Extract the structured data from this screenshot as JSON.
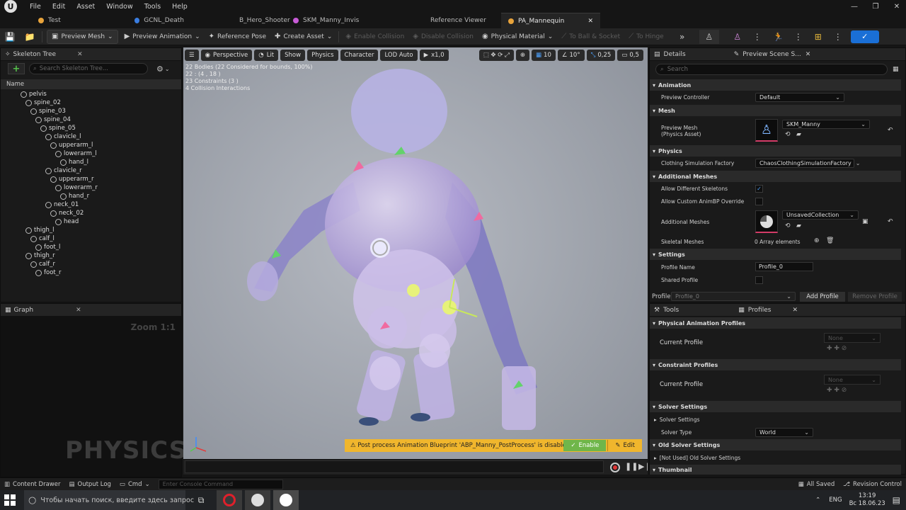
{
  "menu": {
    "items": [
      "File",
      "Edit",
      "Asset",
      "Window",
      "Tools",
      "Help"
    ]
  },
  "tabs": [
    {
      "label": "Test",
      "color": "#e8a33b"
    },
    {
      "label": "GCNL_Death",
      "color": "#3a7de0"
    },
    {
      "label": "B_Hero_ShooterManneq...",
      "color": "#3a7de0"
    },
    {
      "label": "SKM_Manny_Invis",
      "color": "#c75bd6"
    },
    {
      "label": "Reference Viewer",
      "color": ""
    },
    {
      "label": "PA_Mannequin",
      "color": "#e8a33b"
    }
  ],
  "toolbar": {
    "preview_mesh": "Preview Mesh",
    "preview_animation": "Preview Animation",
    "reference_pose": "Reference Pose",
    "create_asset": "Create Asset",
    "enable_collision": "Enable Collision",
    "disable_collision": "Disable Collision",
    "physical_material": "Physical Material",
    "to_ball_socket": "To Ball & Socket",
    "to_hinge": "To Hinge"
  },
  "skeleton_tree": {
    "tab": "Skeleton Tree",
    "search_placeholder": "Search Skeleton Tree...",
    "column": "Name",
    "bones": [
      {
        "name": "pelvis",
        "depth": 0
      },
      {
        "name": "spine_02",
        "depth": 1
      },
      {
        "name": "spine_03",
        "depth": 2
      },
      {
        "name": "spine_04",
        "depth": 3
      },
      {
        "name": "spine_05",
        "depth": 4
      },
      {
        "name": "clavicle_l",
        "depth": 5
      },
      {
        "name": "upperarm_l",
        "depth": 6
      },
      {
        "name": "lowerarm_l",
        "depth": 7
      },
      {
        "name": "hand_l",
        "depth": 8
      },
      {
        "name": "clavicle_r",
        "depth": 5
      },
      {
        "name": "upperarm_r",
        "depth": 6
      },
      {
        "name": "lowerarm_r",
        "depth": 7
      },
      {
        "name": "hand_r",
        "depth": 8
      },
      {
        "name": "neck_01",
        "depth": 5
      },
      {
        "name": "neck_02",
        "depth": 6
      },
      {
        "name": "head",
        "depth": 7
      },
      {
        "name": "thigh_l",
        "depth": 1
      },
      {
        "name": "calf_l",
        "depth": 2
      },
      {
        "name": "foot_l",
        "depth": 3
      },
      {
        "name": "thigh_r",
        "depth": 1
      },
      {
        "name": "calf_r",
        "depth": 2
      },
      {
        "name": "foot_r",
        "depth": 3
      }
    ]
  },
  "graph": {
    "tab": "Graph",
    "zoom": "Zoom 1:1",
    "watermark": "PHYSICS"
  },
  "viewport": {
    "perspective": "Perspective",
    "lit": "Lit",
    "show": "Show",
    "physics": "Physics",
    "character": "Character",
    "lod": "LOD Auto",
    "play_rate": "x1,0",
    "grid_value": "10",
    "angle_value": "10°",
    "scale_value": "0,25",
    "camera_speed": "0,5",
    "info": [
      "22 Bodies (22 Considered for bounds, 100%)",
      "22 : (4 , 18 )",
      "23 Constraints (3 )",
      "4 Collision Interactions"
    ],
    "warning": "Post process Animation Blueprint 'ABP_Manny_PostProcess' is disabled.",
    "enable": "Enable",
    "edit": "Edit"
  },
  "details": {
    "tab": "Details",
    "tab2": "Preview Scene S...",
    "search_placeholder": "Search",
    "sections": {
      "animation": "Animation",
      "mesh": "Mesh",
      "physics": "Physics",
      "additional_meshes": "Additional Meshes",
      "settings": "Settings"
    },
    "props": {
      "preview_controller": "Preview Controller",
      "preview_controller_value": "Default",
      "preview_mesh_line1": "Preview Mesh",
      "preview_mesh_line2": "(Physics Asset)",
      "preview_mesh_value": "SKM_Manny",
      "clothing_factory": "Clothing Simulation Factory",
      "clothing_factory_value": "ChaosClothingSimulationFactory",
      "allow_diff_skeletons": "Allow Different Skeletons",
      "allow_custom_animbp": "Allow Custom AnimBP Override",
      "additional_meshes": "Additional Meshes",
      "additional_meshes_value": "UnsavedCollection",
      "skeletal_meshes": "Skeletal Meshes",
      "skeletal_meshes_value": "0 Array elements",
      "profile_name": "Profile Name",
      "profile_name_value": "Profile_0",
      "shared_profile": "Shared Profile"
    },
    "profile_label": "Profile",
    "profile_value": "Profile_0",
    "add_profile": "Add Profile",
    "remove_profile": "Remove Profile"
  },
  "tools": {
    "tab": "Tools",
    "tab2": "Profiles",
    "physical_animation_profiles": "Physical Animation Profiles",
    "constraint_profiles": "Constraint Profiles",
    "current_profile": "Current Profile",
    "none": "None",
    "solver_settings_section": "Solver Settings",
    "solver_settings": "Solver Settings",
    "solver_type": "Solver Type",
    "solver_type_value": "World",
    "old_solver_settings": "Old Solver Settings",
    "not_used": "[Not Used] Old Solver Settings",
    "thumbnail": "Thumbnail"
  },
  "statusbar": {
    "content_drawer": "Content Drawer",
    "output_log": "Output Log",
    "cmd": "Cmd",
    "console_placeholder": "Enter Console Command",
    "all_saved": "All Saved",
    "revision_control": "Revision Control"
  },
  "taskbar": {
    "search": "Чтобы начать поиск, введите здесь запрос",
    "lang": "ENG",
    "time": "13:19",
    "date": "Вс 18.06.23"
  }
}
